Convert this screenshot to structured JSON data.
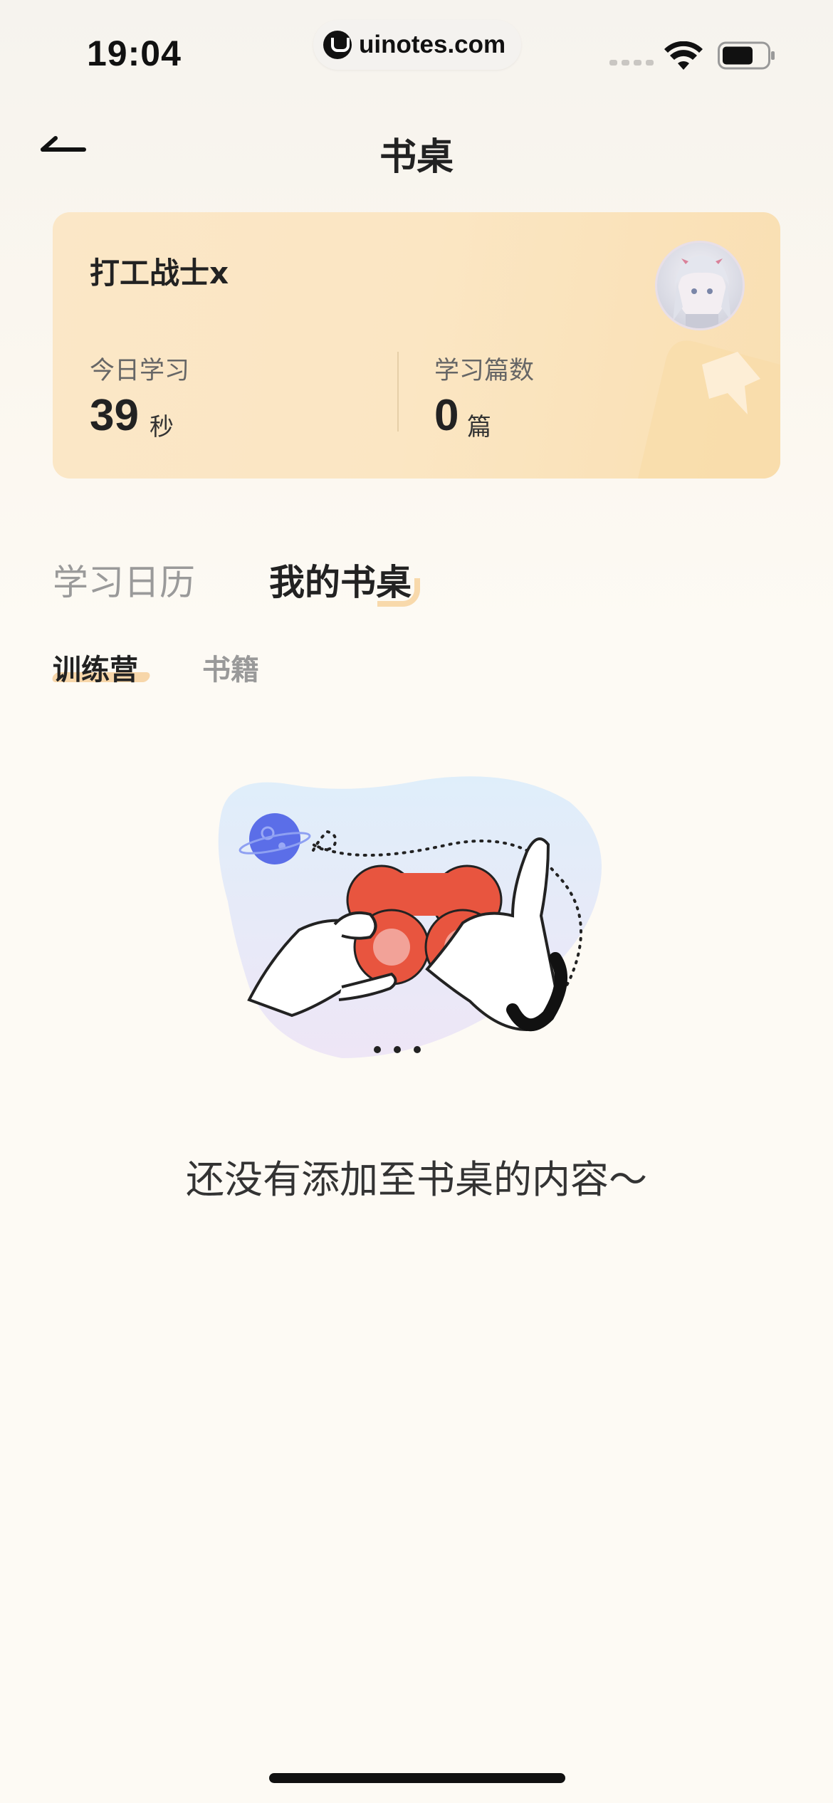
{
  "status_bar": {
    "time": "19:04",
    "url": "uinotes.com",
    "icons": [
      "signal-icon",
      "wifi-icon",
      "battery-icon"
    ]
  },
  "nav": {
    "back_icon": "back-arrow-icon",
    "title": "书桌"
  },
  "profile_card": {
    "user_name": "打工战士x",
    "stats": [
      {
        "label": "今日学习",
        "value": "39",
        "unit": "秒"
      },
      {
        "label": "学习篇数",
        "value": "0",
        "unit": "篇"
      }
    ]
  },
  "tabs": [
    {
      "label": "学习日历",
      "active": false
    },
    {
      "label": "我的书桌",
      "active": true
    }
  ],
  "subtabs": [
    {
      "label": "训练营",
      "active": true
    },
    {
      "label": "书籍",
      "active": false
    }
  ],
  "empty_state": {
    "illustration": "binoculars-illustration",
    "message": "还没有添加至书桌的内容～"
  },
  "colors": {
    "card_background": "#fbe6c3",
    "accent_underline": "#f6cf9b",
    "binoculars": "#e8553f",
    "planet": "#5b6ee8"
  }
}
